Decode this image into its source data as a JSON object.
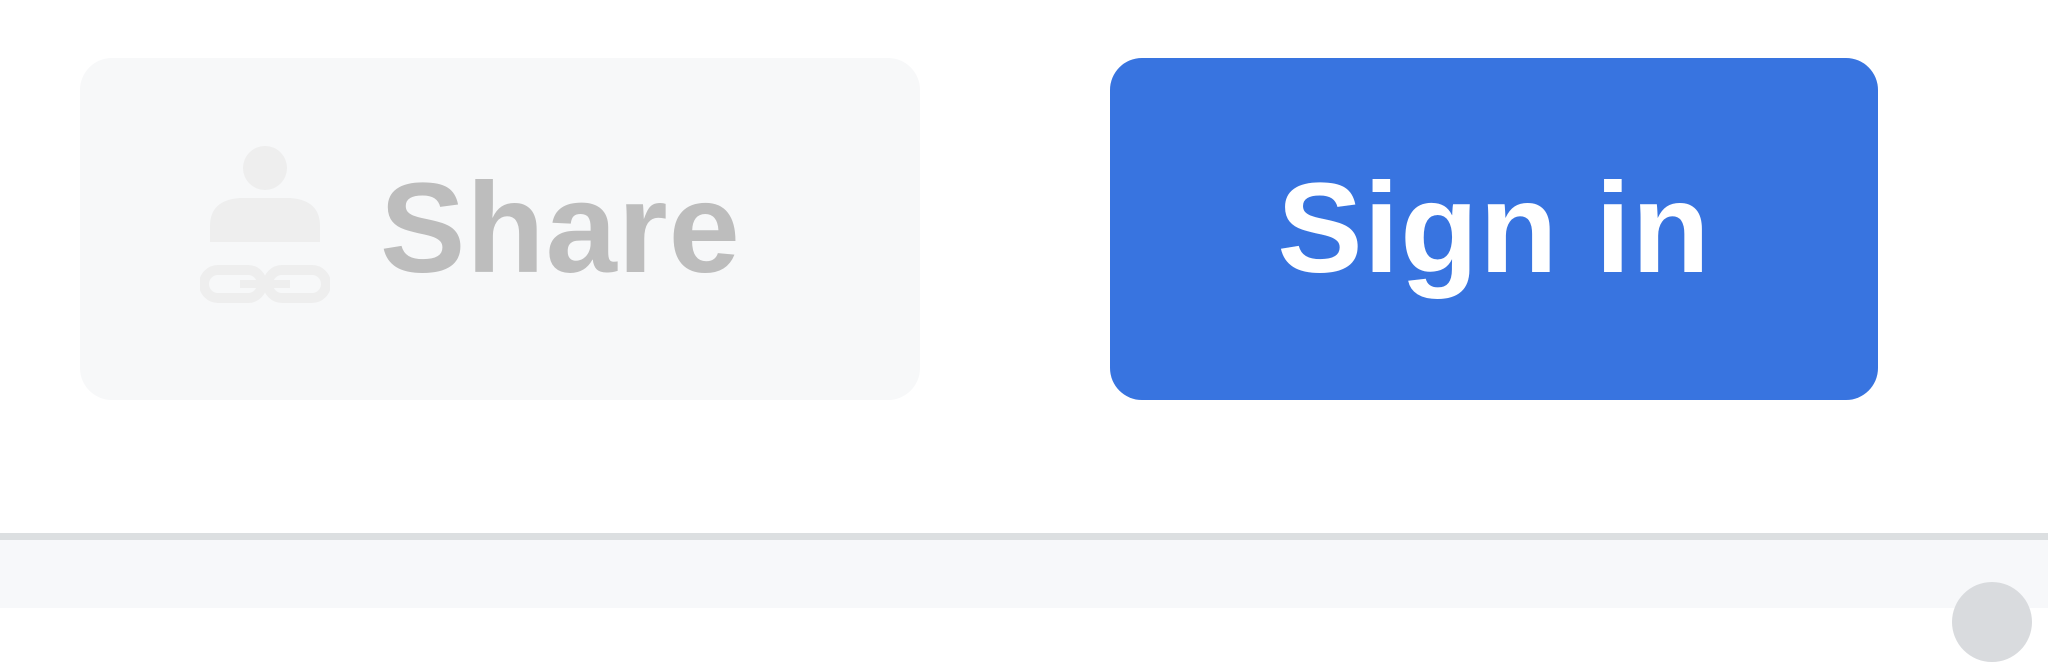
{
  "toolbar": {
    "share_label": "Share",
    "share_icon": "person-link-icon",
    "signin_label": "Sign in"
  },
  "colors": {
    "accent": "#3874e0",
    "share_disabled_text": "#bdbdbd",
    "share_background": "#f7f8f9"
  }
}
